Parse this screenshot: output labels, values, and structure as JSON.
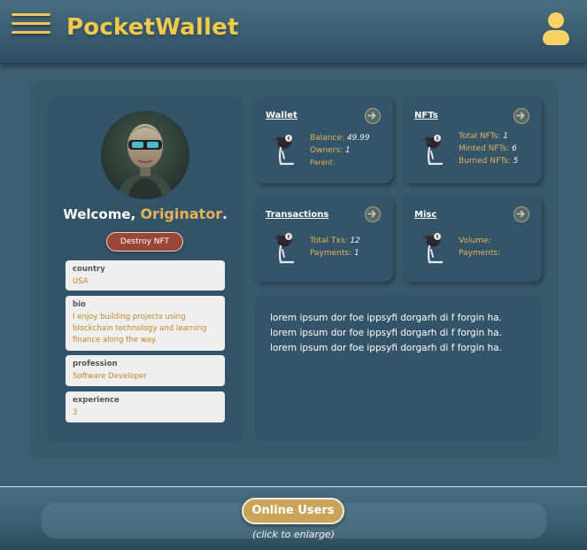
{
  "header": {
    "app_name": "PocketWallet",
    "menu_icon": "hamburger-menu-icon",
    "user_icon": "user-icon"
  },
  "profile": {
    "welcome_prefix": "Welcome,",
    "username": "Originator",
    "welcome_suffix": ".",
    "destroy_button": "Destroy NFT",
    "fields": [
      {
        "label": "country",
        "value": "USA"
      },
      {
        "label": "bio",
        "value": "I enjoy building projects using blockchain technology and learning finance along the way."
      },
      {
        "label": "profession",
        "value": "Software Developer"
      },
      {
        "label": "experience",
        "value": "3"
      }
    ]
  },
  "cards": {
    "wallet": {
      "title": "Wallet",
      "balance_label": "Balance:",
      "balance_value": "49.99",
      "owners_label": "Owners:",
      "owners_value": "1",
      "parent_label": "Parent:"
    },
    "nfts": {
      "title": "NFTs",
      "total_label": "Total NFTs:",
      "total_value": "1",
      "minted_label": "Minted NFTs:",
      "minted_value": "6",
      "burned_label": "Burned NFTs:",
      "burned_value": "5"
    },
    "transactions": {
      "title": "Transactions",
      "txs_label": "Total Txs:",
      "txs_value": "12",
      "payments_label": "Payments:",
      "payments_value": "1"
    },
    "misc": {
      "title": "Misc",
      "volume_label": "Volume:",
      "payments_label": "Payments:"
    }
  },
  "lorem": {
    "text": "lorem ipsum dor foe ippsyfi dorgarh di f forgin ha. lorem ipsum dor foe ippsyfi dorgarh di f forgin ha. lorem ipsum dor foe ippsyfi dorgarh di f forgin ha."
  },
  "footer": {
    "online_users_button": "Online Users",
    "hint": "(click to enlarge)"
  },
  "colors": {
    "accent": "#f2c94c",
    "background": "#3d5e72",
    "card": "#34546a",
    "danger": "#9a4638"
  }
}
